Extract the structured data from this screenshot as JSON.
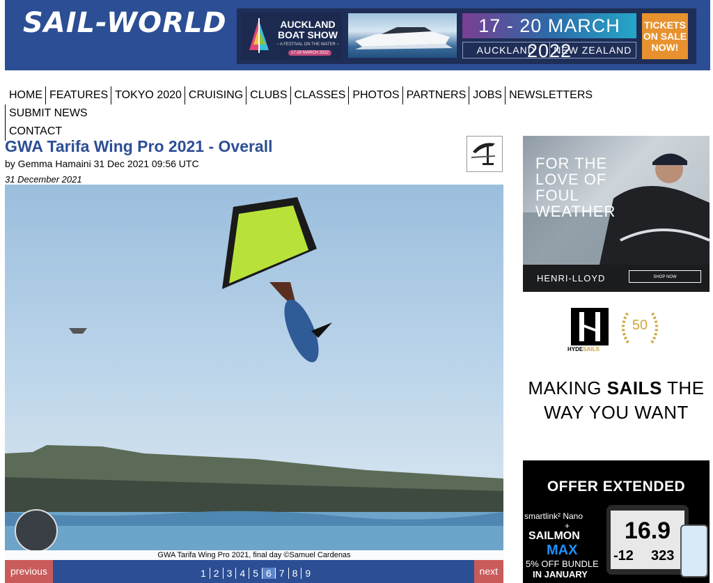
{
  "header": {
    "logo_text": "SAIL-WORLD",
    "banner": {
      "show_line1": "AUCKLAND",
      "show_line2": "BOAT SHOW",
      "tagline": "~ A FESTIVAL ON THE WATER ~",
      "date_small": "17-20 MARCH 2022",
      "dates": "17 - 20 MARCH 2022",
      "city": "AUCKLAND",
      "country": "NEW ZEALAND",
      "cta": "TICKETS\nON SALE\nNOW!"
    }
  },
  "nav": {
    "items": [
      "HOME",
      "FEATURES",
      "TOKYO 2020",
      "CRUISING",
      "CLUBS",
      "CLASSES",
      "PHOTOS",
      "PARTNERS",
      "JOBS",
      "NEWSLETTERS",
      "SUBMIT NEWS",
      "CONTACT"
    ]
  },
  "article": {
    "title": "GWA Tarifa Wing Pro 2021 - Overall",
    "byline": "by Gemma Hamaini 31 Dec 2021 09:56 UTC",
    "date": "31 December 2021",
    "category_icon": "wingfoil-icon",
    "photo": {
      "caption": "GWA Tarifa Wing Pro 2021, final day ©Samuel Cardenas",
      "watermark_icon": "gwa-logo"
    },
    "pager": {
      "previous": "previous",
      "next": "next",
      "pages": [
        "1",
        "2",
        "3",
        "4",
        "5",
        "6",
        "7",
        "8",
        "9"
      ],
      "current": "6"
    }
  },
  "sidebar": {
    "ad1": {
      "headline": "FOR THE\nLOVE OF\nFOUL\nWEATHER",
      "brand": "HENRI-LLOYD",
      "cta": "SHOP NOW"
    },
    "ad2": {
      "brand_prefix": "HYDE",
      "brand_suffix": "SAILS",
      "anniversary": "50",
      "line1_pre": "MAKING ",
      "line1_bold": "SAILS",
      "line1_post": " THE",
      "line2": "WAY YOU WANT"
    },
    "ad3": {
      "headline": "OFFER EXTENDED",
      "product1": "smartlink² Nano",
      "plus": "+",
      "brand": "SAILMON",
      "product2": "MAX",
      "offer": "5% OFF BUNDLE",
      "period": "IN JANUARY",
      "display_top": "16.9",
      "display_left": "-12",
      "display_right": "323"
    }
  },
  "colors": {
    "header_blue": "#2c4e94",
    "title_blue": "#2c4e94",
    "pager_red": "#c95b5b",
    "tickets_orange": "#e8922f"
  }
}
